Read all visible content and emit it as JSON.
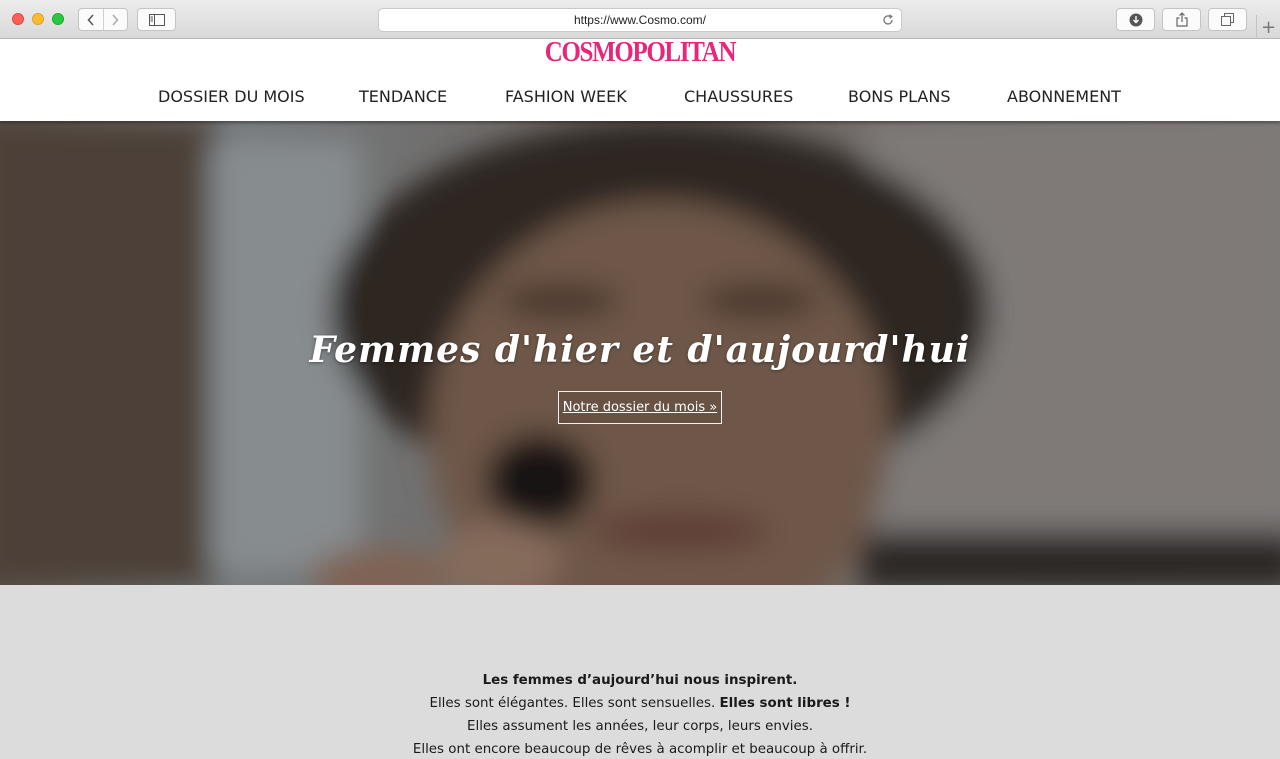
{
  "browser": {
    "url": "https://www.Cosmo.com/"
  },
  "site": {
    "logo": "COSMOPOLITAN",
    "brand_color": "#e8267a",
    "nav": [
      {
        "label": "DOSSIER DU MOIS"
      },
      {
        "label": "TENDANCE"
      },
      {
        "label": "FASHION WEEK"
      },
      {
        "label": "CHAUSSURES"
      },
      {
        "label": "BONS PLANS"
      },
      {
        "label": "ABONNEMENT"
      }
    ]
  },
  "hero": {
    "title": "Femmes d'hier et d'aujourd'hui",
    "cta": "Notre dossier du mois »"
  },
  "intro": {
    "line1": "Les femmes d’aujourd’hui nous inspirent.",
    "line2_a": "Elles sont élégantes. Elles sont sensuelles. ",
    "line2_b": "Elles sont libres !",
    "line3": "Elles assument les années, leur corps, leurs envies.",
    "line4": "Elles ont encore beaucoup de rêves à acomplir et beaucoup à offrir."
  }
}
